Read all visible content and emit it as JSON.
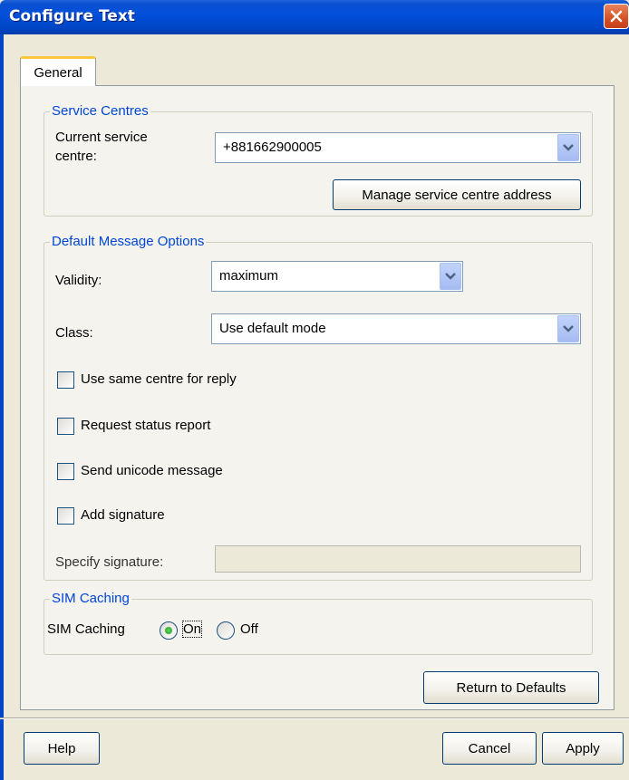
{
  "window": {
    "title": "Configure Text"
  },
  "tabs": [
    {
      "label": "General",
      "selected": true
    }
  ],
  "service_centres": {
    "group_title": "Service Centres",
    "current_label_line1": "Current service",
    "current_label_line2": "centre:",
    "current_value": "+881662900005",
    "manage_button": "Manage service centre address"
  },
  "default_options": {
    "group_title": "Default Message Options",
    "validity_label": "Validity:",
    "validity_value": "maximum",
    "class_label": "Class:",
    "class_value": "Use default mode",
    "checkboxes": [
      {
        "label": "Use same centre for reply",
        "checked": false
      },
      {
        "label": "Request status report",
        "checked": false
      },
      {
        "label": "Send unicode message",
        "checked": false
      },
      {
        "label": "Add signature",
        "checked": false
      }
    ],
    "signature_label": "Specify signature:",
    "signature_value": ""
  },
  "sim_caching": {
    "group_title": "SIM Caching",
    "label": "SIM Caching",
    "on_label": "On",
    "off_label": "Off",
    "selected": "On"
  },
  "buttons": {
    "return_defaults": "Return to Defaults",
    "help": "Help",
    "cancel": "Cancel",
    "apply": "Apply"
  },
  "colors": {
    "titlebar": "#0046C8",
    "group_title": "#0046D5",
    "dialog_bg": "#ECE9D8",
    "panel_bg": "#F4F3EE"
  }
}
